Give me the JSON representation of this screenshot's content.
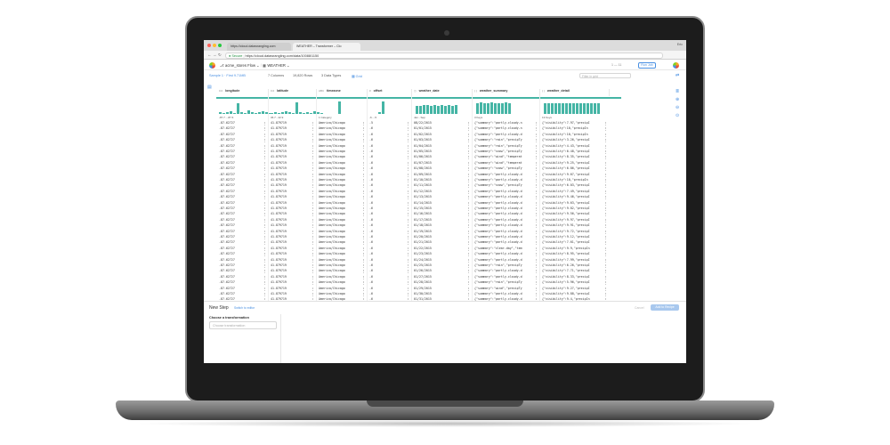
{
  "browser": {
    "tabs": [
      {
        "label": "https://cloud.datawrangling.com"
      },
      {
        "label": "WEATHER – Transformer – Clo"
      }
    ],
    "user_label": "Eric",
    "secure_label": "Secure",
    "url": "https://cloud.datawrangling.com/data/10088/1150"
  },
  "app": {
    "flow_title": "acme_stores Flow",
    "dataset_name": "WEATHER",
    "pager": "1 — 11",
    "run_job_label": "Run Job"
  },
  "toolbar": {
    "sample_label": "Sample 1 · First 9.71MB",
    "columns_label": "7 Columns",
    "rows_label": "19,820 Rows",
    "types_label": "3 Data Types",
    "view_label": "Grid",
    "filter_placeholder": "Filter in grid"
  },
  "columns": [
    {
      "type": "0.0",
      "name": "longitude",
      "summary": "-87.7 - -87.6"
    },
    {
      "type": "0.0",
      "name": "latitude",
      "summary": "36.7 - 42.9"
    },
    {
      "type": "ABC",
      "name": "timezone",
      "summary": "1 Category"
    },
    {
      "type": "#",
      "name": "offset",
      "summary": "-6 - -5"
    },
    {
      "type": "clock",
      "name": "weather_date",
      "summary": "Jan - Sep"
    },
    {
      "type": "obj",
      "name": "weather_summary",
      "summary": "3 Keys"
    },
    {
      "type": "obj",
      "name": "weather_detail",
      "summary": "13 Keys"
    }
  ],
  "rows": [
    [
      "-87.62727",
      "41.879719",
      "America/Chicago",
      "-5",
      "08/22/2015",
      "{\"summary\":\"partly-cloudy-n",
      "{\"visibility\":7.97,\"precipI"
    ],
    [
      "-87.62727",
      "41.879719",
      "America/Chicago",
      "-6",
      "01/01/2015",
      "{\"summary\":\"partly-cloudy-n",
      "{\"visibility\":10,\"precipIn"
    ],
    [
      "-87.62727",
      "41.879719",
      "America/Chicago",
      "-6",
      "01/02/2015",
      "{\"summary\":\"partly-cloudy-d",
      "{\"visibility\":10,\"precipIn"
    ],
    [
      "-87.62727",
      "41.879719",
      "America/Chicago",
      "-6",
      "01/03/2015",
      "{\"summary\":\"rain\",\"precipTy",
      "{\"visibility\":3.26,\"precipI"
    ],
    [
      "-87.62727",
      "41.879719",
      "America/Chicago",
      "-6",
      "01/04/2015",
      "{\"summary\":\"rain\",\"precipTy",
      "{\"visibility\":4.43,\"precipI"
    ],
    [
      "-87.62727",
      "41.879719",
      "America/Chicago",
      "-6",
      "01/05/2015",
      "{\"summary\":\"snow\",\"precipTy",
      "{\"visibility\":6.48,\"precipI"
    ],
    [
      "-87.62727",
      "41.879719",
      "America/Chicago",
      "-6",
      "01/06/2015",
      "{\"summary\":\"wind\",\"temperat",
      "{\"visibility\":8.35,\"precipI"
    ],
    [
      "-87.62727",
      "41.879719",
      "America/Chicago",
      "-6",
      "01/07/2015",
      "{\"summary\":\"wind\",\"temperat",
      "{\"visibility\":9.25,\"precipI"
    ],
    [
      "-87.62727",
      "41.879719",
      "America/Chicago",
      "-6",
      "01/08/2015",
      "{\"summary\":\"snow\",\"precipTy",
      "{\"visibility\":6.86,\"precipI"
    ],
    [
      "-87.62727",
      "41.879719",
      "America/Chicago",
      "-6",
      "01/09/2015",
      "{\"summary\":\"partly-cloudy-d",
      "{\"visibility\":9.67,\"precipI"
    ],
    [
      "-87.62727",
      "41.879719",
      "America/Chicago",
      "-6",
      "01/10/2015",
      "{\"summary\":\"partly-cloudy-d",
      "{\"visibility\":10,\"precipIn"
    ],
    [
      "-87.62727",
      "41.879719",
      "America/Chicago",
      "-6",
      "01/11/2015",
      "{\"summary\":\"snow\",\"precipTy",
      "{\"visibility\":6.03,\"precipI"
    ],
    [
      "-87.62727",
      "41.879719",
      "America/Chicago",
      "-6",
      "01/12/2015",
      "{\"summary\":\"partly-cloudy-d",
      "{\"visibility\":7.49,\"precipI"
    ],
    [
      "-87.62727",
      "41.879719",
      "America/Chicago",
      "-6",
      "01/13/2015",
      "{\"summary\":\"partly-cloudy-d",
      "{\"visibility\":9.46,\"precipI"
    ],
    [
      "-87.62727",
      "41.879719",
      "America/Chicago",
      "-6",
      "01/14/2015",
      "{\"summary\":\"partly-cloudy-d",
      "{\"visibility\":9.63,\"precipI"
    ],
    [
      "-87.62727",
      "41.879719",
      "America/Chicago",
      "-6",
      "01/15/2015",
      "{\"summary\":\"partly-cloudy-d",
      "{\"visibility\":9.82,\"precipI"
    ],
    [
      "-87.62727",
      "41.879719",
      "America/Chicago",
      "-6",
      "01/16/2015",
      "{\"summary\":\"partly-cloudy-d",
      "{\"visibility\":9.56,\"precipI"
    ],
    [
      "-87.62727",
      "41.879719",
      "America/Chicago",
      "-6",
      "01/17/2015",
      "{\"summary\":\"partly-cloudy-d",
      "{\"visibility\":9.97,\"precipI"
    ],
    [
      "-87.62727",
      "41.879719",
      "America/Chicago",
      "-6",
      "01/18/2015",
      "{\"summary\":\"partly-cloudy-d",
      "{\"visibility\":9.91,\"precipI"
    ],
    [
      "-87.62727",
      "41.879719",
      "America/Chicago",
      "-6",
      "01/19/2015",
      "{\"summary\":\"partly-cloudy-d",
      "{\"visibility\":9.72,\"precipI"
    ],
    [
      "-87.62727",
      "41.879719",
      "America/Chicago",
      "-6",
      "01/20/2015",
      "{\"summary\":\"partly-cloudy-d",
      "{\"visibility\":9.12,\"precipI"
    ],
    [
      "-87.62727",
      "41.879719",
      "America/Chicago",
      "-6",
      "01/21/2015",
      "{\"summary\":\"partly-cloudy-d",
      "{\"visibility\":7.61,\"precipI"
    ],
    [
      "-87.62727",
      "41.879719",
      "America/Chicago",
      "-6",
      "01/22/2015",
      "{\"summary\":\"clear-day\",\"tem",
      "{\"visibility\":9.9,\"precipIn"
    ],
    [
      "-87.62727",
      "41.879719",
      "America/Chicago",
      "-6",
      "01/23/2015",
      "{\"summary\":\"partly-cloudy-d",
      "{\"visibility\":8.95,\"precipI"
    ],
    [
      "-87.62727",
      "41.879719",
      "America/Chicago",
      "-6",
      "01/24/2015",
      "{\"summary\":\"partly-cloudy-d",
      "{\"visibility\":7.99,\"precipI"
    ],
    [
      "-87.62727",
      "41.879719",
      "America/Chicago",
      "-6",
      "01/25/2015",
      "{\"summary\":\"rain\",\"precipTy",
      "{\"visibility\":6.26,\"precipI"
    ],
    [
      "-87.62727",
      "41.879719",
      "America/Chicago",
      "-6",
      "01/26/2015",
      "{\"summary\":\"partly-cloudy-d",
      "{\"visibility\":7.71,\"precipI"
    ],
    [
      "-87.62727",
      "41.879719",
      "America/Chicago",
      "-6",
      "01/27/2015",
      "{\"summary\":\"partly-cloudy-d",
      "{\"visibility\":8.33,\"precipI"
    ],
    [
      "-87.62727",
      "41.879719",
      "America/Chicago",
      "-6",
      "01/28/2015",
      "{\"summary\":\"rain\",\"precipTy",
      "{\"visibility\":5.96,\"precipI"
    ],
    [
      "-87.62727",
      "41.879719",
      "America/Chicago",
      "-6",
      "01/29/2015",
      "{\"summary\":\"wind\",\"precipTy",
      "{\"visibility\":9.27,\"precipI"
    ],
    [
      "-87.62727",
      "41.879719",
      "America/Chicago",
      "-6",
      "01/30/2015",
      "{\"summary\":\"partly-cloudy-d",
      "{\"visibility\":9.88,\"precipI"
    ],
    [
      "-87.62727",
      "41.879719",
      "America/Chicago",
      "-6",
      "01/31/2015",
      "{\"summary\":\"partly-cloudy-d",
      "{\"visibility\":9.4,\"precipIn"
    ]
  ],
  "bottom_panel": {
    "title": "New Step",
    "switch_label": "Switch to editor",
    "cancel_label": "Cancel",
    "add_label": "Add to Recipe",
    "choose_label": "Choose a transformation",
    "input_placeholder": "Choose transformation"
  },
  "colors": {
    "accent": "#4a90e2",
    "histogram": "#45b5a5"
  }
}
